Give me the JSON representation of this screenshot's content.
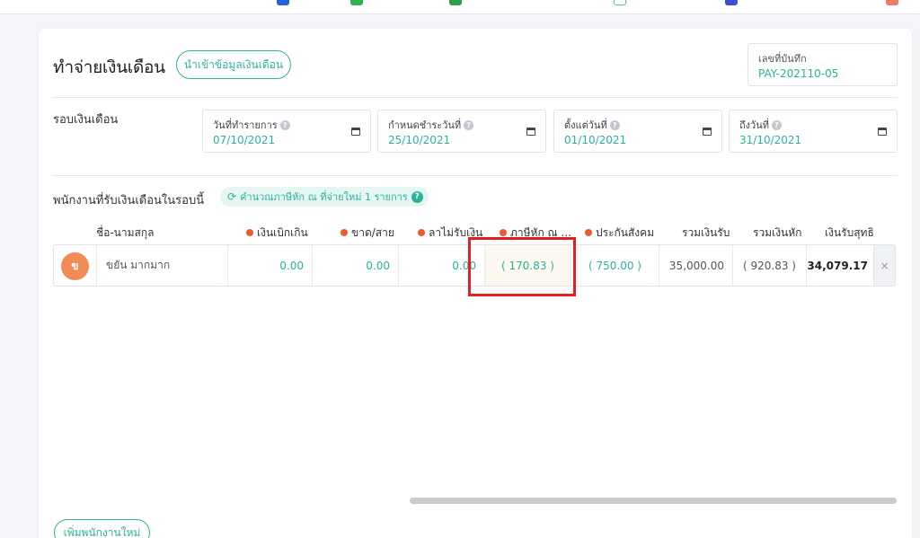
{
  "title": "ทำจ่ายเงินเดือน",
  "import_button": "นำเข้าข้อมูลเงินเดือน",
  "doc": {
    "label": "เลขที่บันทึก",
    "value": "PAY-202110-05"
  },
  "period": {
    "label": "รอบเงินเดือน",
    "fields": [
      {
        "label": "วันที่ทำรายการ",
        "value": "07/10/2021"
      },
      {
        "label": "กำหนดชำระวันที่",
        "value": "25/10/2021"
      },
      {
        "label": "ตั้งแต่วันที่",
        "value": "01/10/2021"
      },
      {
        "label": "ถึงวันที่",
        "value": "31/10/2021"
      }
    ]
  },
  "employees_section": {
    "label": "พนักงานที่รับเงินเดือนในรอบนี้",
    "recalc_button": "คำนวณภาษีหัก ณ ที่จ่ายใหม่ 1 รายการ"
  },
  "columns": {
    "name": "ชื่อ-นามสกุล",
    "advance": "เงินเบิกเกิน",
    "absent_late": "ขาด/สาย",
    "unpaid_leave": "ลาไม่รับเงิน",
    "tax": "ภาษีหัก ณ ...",
    "social_security": "ประกันสังคม",
    "total_income": "รวมเงินรับ",
    "total_deduction": "รวมเงินหัก",
    "net_pay": "เงินรับสุทธิ"
  },
  "row": {
    "avatar_letter": "ข",
    "name": "ขยัน มากมาก",
    "advance": "0.00",
    "absent_late": "0.00",
    "unpaid_leave": "0.00",
    "tax": "( 170.83 )",
    "social_security": "( 750.00 )",
    "total_income": "35,000.00",
    "total_deduction": "( 920.83 )",
    "net_pay": "34,079.17",
    "remove": "×"
  },
  "add_employee_button": "เพิ่มพนักงานใหม่",
  "colors": {
    "accent": "#2bb39a",
    "required_dot": "#ef5a2c",
    "highlight": "#e32020"
  }
}
